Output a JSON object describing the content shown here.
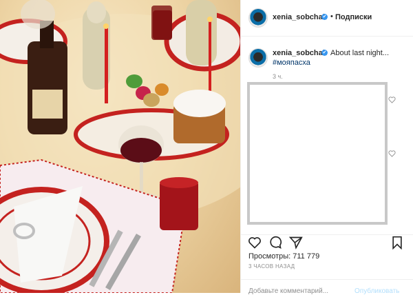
{
  "post": {
    "username": "xenia_sobchak",
    "verified_mark": "✔",
    "separator": "•",
    "follow_label": "Подписки",
    "caption": "About last night...",
    "hashtag": "#мояпасха",
    "time_short": "3 ч.",
    "views_label": "Просмотры: 711 779",
    "time_full": "3 ЧАСОВ НАЗАД",
    "comment_placeholder": "Добавьте комментарий...",
    "publish_label": "Опубликовать"
  },
  "icons": {
    "heart": "heart-icon",
    "comment": "comment-icon",
    "share": "share-icon",
    "bookmark": "bookmark-icon",
    "comment_like": "small-heart-icon"
  },
  "colors": {
    "link": "#003569",
    "verified": "#3897f0",
    "publish_disabled": "#b2dffc"
  }
}
